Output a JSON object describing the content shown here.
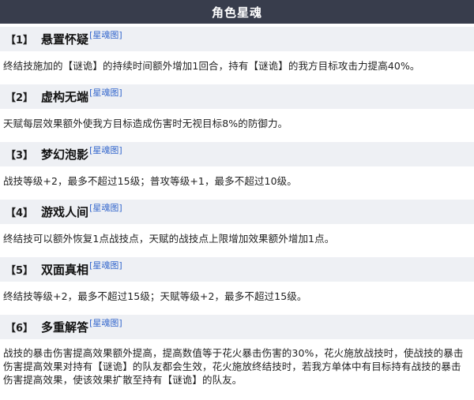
{
  "title": "角色星魂",
  "eidolons": [
    {
      "num": "【1】",
      "name": "悬置怀疑",
      "link": "[星魂图]",
      "desc": "终结技施加的【谜诡】的持续时间额外增加1回合，持有【谜诡】的我方目标攻击力提高40%。"
    },
    {
      "num": "【2】",
      "name": "虚构无端",
      "link": "[星魂图]",
      "desc": "天赋每层效果额外使我方目标造成伤害时无视目标8%的防御力。"
    },
    {
      "num": "【3】",
      "name": "梦幻泡影",
      "link": "[星魂图]",
      "desc": "战技等级+2，最多不超过15级；普攻等级+1，最多不超过10级。"
    },
    {
      "num": "【4】",
      "name": "游戏人间",
      "link": "[星魂图]",
      "desc": "终结技可以额外恢复1点战技点，天赋的战技点上限增加效果额外增加1点。"
    },
    {
      "num": "【5】",
      "name": "双面真相",
      "link": "[星魂图]",
      "desc": "终结技等级+2，最多不超过15级；天赋等级+2，最多不超过15级。"
    },
    {
      "num": "【6】",
      "name": "多重解答",
      "link": "[星魂图]",
      "desc": "战技的暴击伤害提高效果额外提高，提高数值等于花火暴击伤害的30%，花火施放战技时，使战技的暴击伤害提高效果对持有【谜诡】的队友都会生效，花火施放终结技时，若我方单体中有目标持有战技的暴击伤害提高效果，使该效果扩散至持有【谜诡】的队友。"
    }
  ]
}
